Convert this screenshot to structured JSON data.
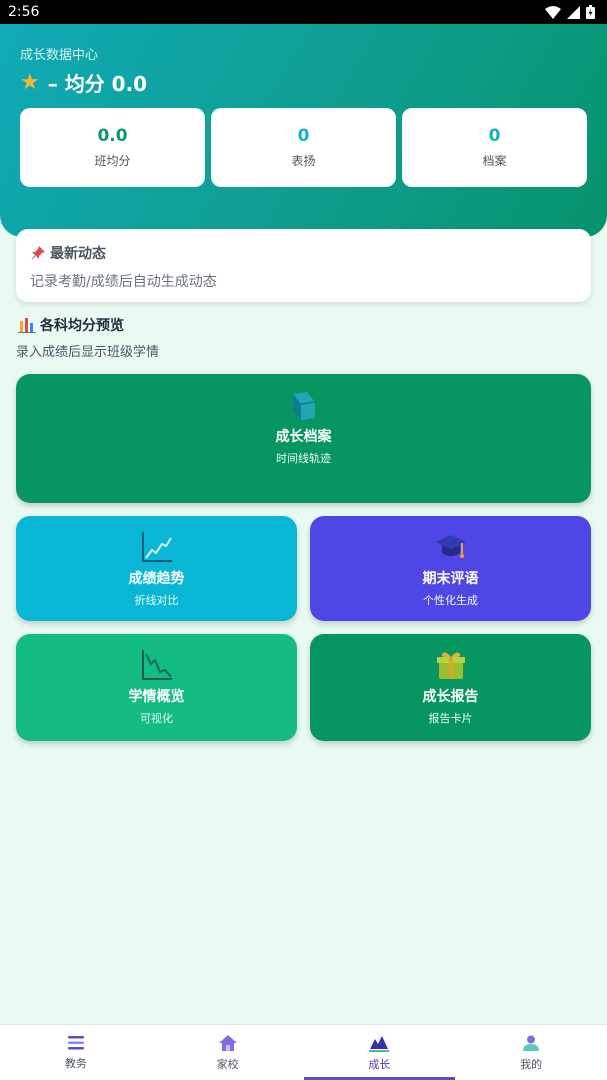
{
  "status_bar": {
    "time": "2:56"
  },
  "header": {
    "subtitle": "成长数据中心",
    "title": "– 均分 0.0",
    "stats": [
      {
        "value": "0.0",
        "label": "班均分"
      },
      {
        "value": "0",
        "label": "表扬"
      },
      {
        "value": "0",
        "label": "档案"
      }
    ]
  },
  "news": {
    "title": "最新动态",
    "text": "记录考勤/成绩后自动生成动态"
  },
  "preview": {
    "title": "各科均分预览",
    "subtitle": "录入成绩后显示班级学情"
  },
  "tiles": {
    "archive": {
      "title": "成长档案",
      "sub": "时间线轨迹"
    },
    "trend": {
      "title": "成绩趋势",
      "sub": "折线对比"
    },
    "review": {
      "title": "期末评语",
      "sub": "个性化生成"
    },
    "overview": {
      "title": "学情概览",
      "sub": "可视化"
    },
    "report": {
      "title": "成长报告",
      "sub": "报告卡片"
    }
  },
  "nav": [
    {
      "label": "教务"
    },
    {
      "label": "家校"
    },
    {
      "label": "成长"
    },
    {
      "label": "我的"
    }
  ],
  "colors": {
    "header_start": "#10aab6",
    "header_end": "#07936b",
    "accent_green": "#07965f",
    "accent_cyan": "#09b6d6",
    "accent_indigo": "#4f47e5",
    "active_nav": "#5b4bc4"
  }
}
